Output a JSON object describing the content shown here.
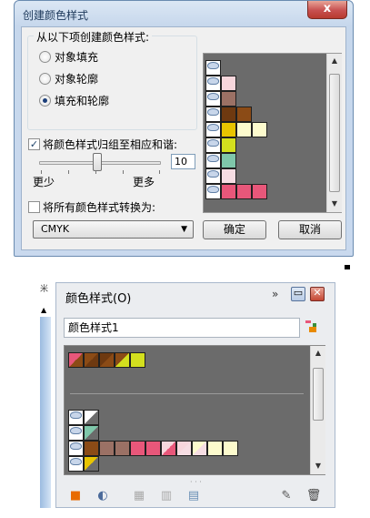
{
  "dialog": {
    "title": "创建颜色样式",
    "close": "x",
    "group_title": "从以下项创建颜色样式:",
    "radios": [
      {
        "label": "对象填充",
        "selected": false
      },
      {
        "label": "对象轮廓",
        "selected": false
      },
      {
        "label": "填充和轮廓",
        "selected": true
      }
    ],
    "group_check": {
      "label": "将颜色样式归组至相应和谐:",
      "checked": true
    },
    "slider": {
      "value": "10",
      "min_label": "更少",
      "max_label": "更多"
    },
    "convert_check": {
      "label": "将所有颜色样式转换为:",
      "checked": false
    },
    "convert_value": "CMYK",
    "ok": "确定",
    "cancel": "取消"
  },
  "docker": {
    "title": "颜色样式(O)",
    "expand": "»",
    "name_value": "颜色样式1",
    "menu_glyph": "米"
  },
  "colors": {
    "pink": "#e8577a",
    "light_pink": "#f7d6dc",
    "brown": "#8b4b16",
    "dark_brown": "#6e3910",
    "taupe": "#9b7165",
    "yellow": "#e8c400",
    "lime": "#d3df1e",
    "cream": "#fdfbcd",
    "teal": "#7fc7aa",
    "pale_pink": "#f6dde3",
    "white": "#ffffff"
  }
}
